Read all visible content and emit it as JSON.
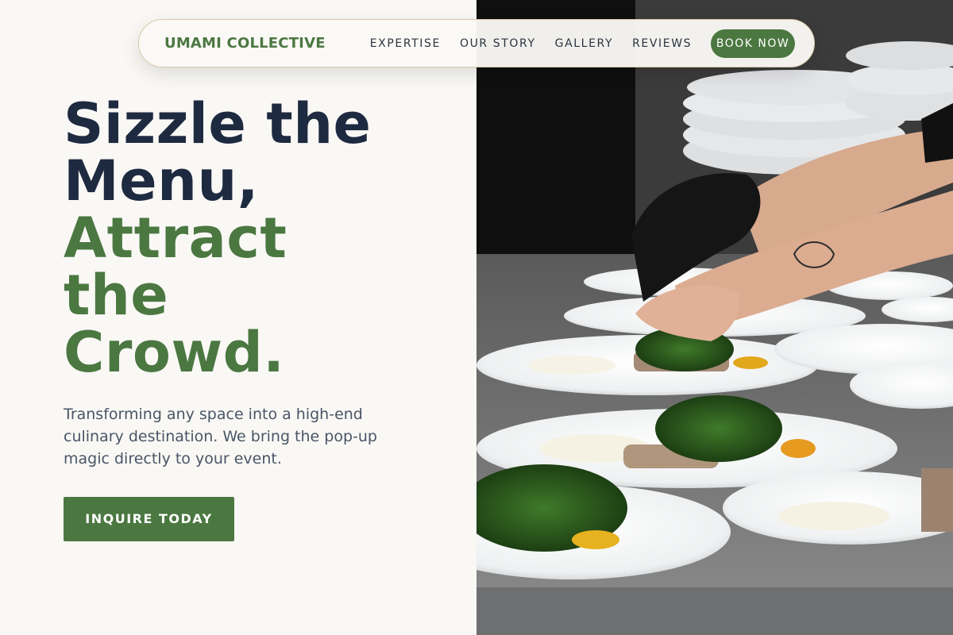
{
  "nav": {
    "brand": "UMAMI COLLECTIVE",
    "links": [
      "EXPERTISE",
      "OUR STORY",
      "GALLERY",
      "REVIEWS"
    ],
    "cta": "BOOK NOW"
  },
  "hero": {
    "headline_dark_1": "Sizzle the",
    "headline_dark_2": "Menu,",
    "headline_green_1": "Attract",
    "headline_green_2": "the",
    "headline_green_3": "Crowd.",
    "subtext": "Transforming any space into a high-end culinary destination. We bring the pop-up magic directly to your event.",
    "cta": "INQUIRE TODAY"
  },
  "colors": {
    "brand_green": "#4b7741",
    "heading_navy": "#1e2a40",
    "body_text": "#4a5565",
    "background": "#f9f8f5"
  },
  "photo": {
    "subject": "chef plating dishes"
  }
}
